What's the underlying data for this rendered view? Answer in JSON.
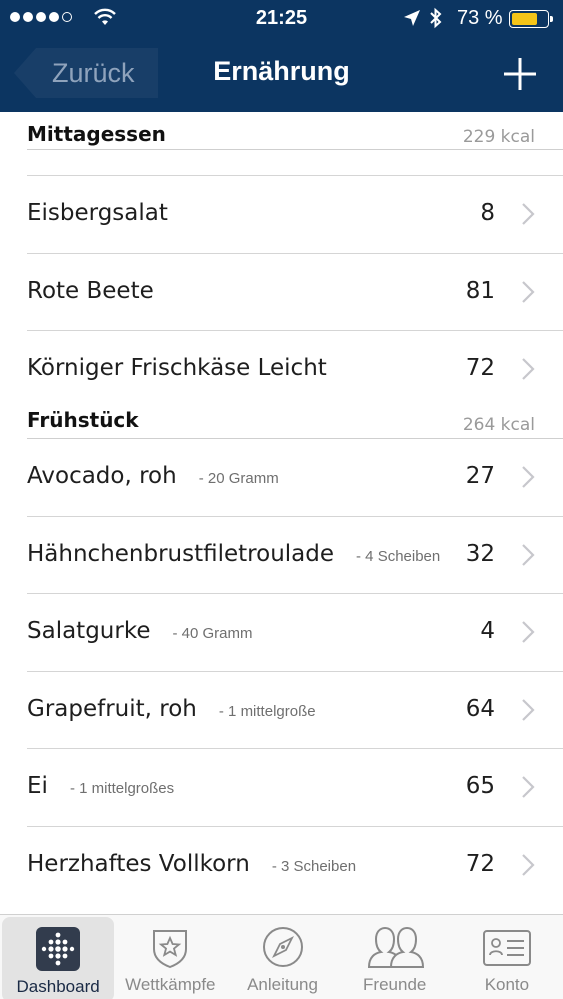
{
  "status_bar": {
    "time": "21:25",
    "battery_percent": "73 %",
    "battery_level": 0.73,
    "signal_bars": 4,
    "signal_total": 5
  },
  "nav": {
    "back_label": "Zurück",
    "title": "Ernährung",
    "add_icon": "plus-icon"
  },
  "colors": {
    "header_bg": "#0c3561",
    "battery": "#f5c518"
  },
  "sections": [
    {
      "title": "Mittagessen",
      "kcal": "229 kcal",
      "items": [
        {
          "name": "Eisbergsalat",
          "portion": "",
          "value": "8"
        },
        {
          "name": "Rote Beete",
          "portion": "",
          "value": "81"
        },
        {
          "name": "Körniger Frischkäse Leicht",
          "portion": "",
          "value": "72"
        }
      ]
    },
    {
      "title": "Frühstück",
      "kcal": "264 kcal",
      "items": [
        {
          "name": "Avocado, roh",
          "portion": "- 20 Gramm",
          "value": "27"
        },
        {
          "name": "Hähnchenbrustfiletroulade",
          "portion": "- 4 Scheiben",
          "value": "32"
        },
        {
          "name": "Salatgurke",
          "portion": "- 40 Gramm",
          "value": "4"
        },
        {
          "name": "Grapefruit, roh",
          "portion": "- 1 mittelgroße",
          "value": "64"
        },
        {
          "name": "Ei",
          "portion": "- 1 mittelgroßes",
          "value": "65"
        },
        {
          "name": "Herzhaftes Vollkorn",
          "portion": "- 3 Scheiben",
          "value": "72"
        }
      ]
    }
  ],
  "tabbar": {
    "tabs": [
      {
        "label": "Dashboard",
        "icon": "dashboard-dots-icon",
        "active": true
      },
      {
        "label": "Wettkämpfe",
        "icon": "star-shield-icon",
        "active": false
      },
      {
        "label": "Anleitung",
        "icon": "compass-icon",
        "active": false
      },
      {
        "label": "Freunde",
        "icon": "friends-icon",
        "active": false
      },
      {
        "label": "Konto",
        "icon": "id-card-icon",
        "active": false
      }
    ]
  }
}
